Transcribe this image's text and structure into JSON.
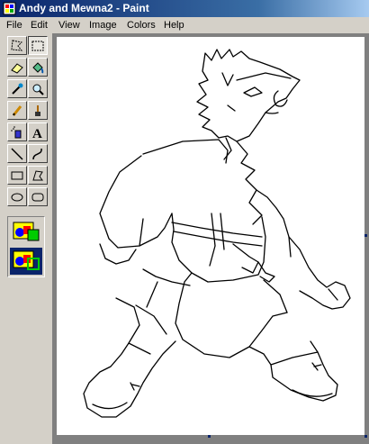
{
  "window": {
    "title": "Andy and Mewna2 - Paint"
  },
  "menu": [
    "File",
    "Edit",
    "View",
    "Image",
    "Colors",
    "Help"
  ],
  "tools": [
    {
      "name": "free-form-select-icon"
    },
    {
      "name": "rect-select-icon"
    },
    {
      "name": "eraser-icon"
    },
    {
      "name": "fill-bucket-icon"
    },
    {
      "name": "color-picker-icon"
    },
    {
      "name": "magnifier-icon"
    },
    {
      "name": "pencil-icon"
    },
    {
      "name": "brush-icon"
    },
    {
      "name": "airbrush-icon"
    },
    {
      "name": "text-tool-icon"
    },
    {
      "name": "line-icon"
    },
    {
      "name": "curve-icon"
    },
    {
      "name": "rectangle-icon"
    },
    {
      "name": "polygon-icon"
    },
    {
      "name": "ellipse-icon"
    },
    {
      "name": "rounded-rect-icon"
    }
  ],
  "text_tool_glyph": "A",
  "colors": {
    "titlebar_start": "#0a246a",
    "titlebar_end": "#a6caf0",
    "face": "#d4d0c8",
    "workspace": "#808080",
    "canvas": "#ffffff"
  }
}
